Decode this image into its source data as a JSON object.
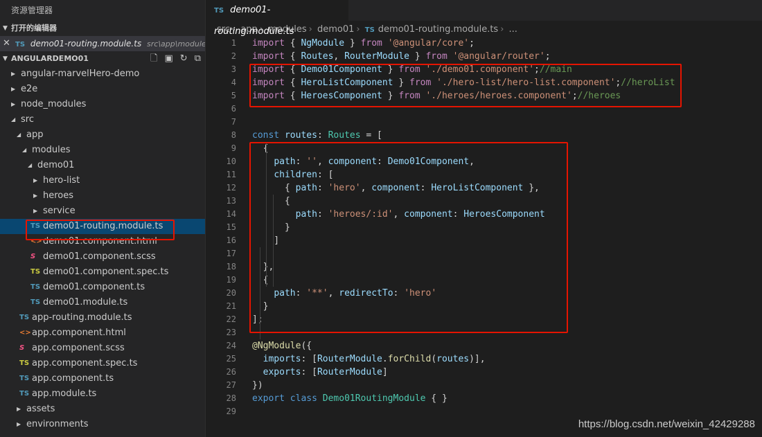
{
  "sidebar": {
    "title": "资源管理器",
    "open_editors": {
      "header": "打开的编辑器",
      "items": [
        {
          "icon": "TS",
          "name": "demo01-routing.module.ts",
          "path": "src\\app\\module..."
        }
      ]
    },
    "project": {
      "header": "ANGULARDEMO01",
      "actions": [
        "new-file-icon",
        "new-folder-icon",
        "refresh-icon",
        "collapse-all-icon"
      ]
    },
    "tree": [
      {
        "label": "angular-marvelHero-demo",
        "type": "folder",
        "depth": 0,
        "expanded": false
      },
      {
        "label": "e2e",
        "type": "folder",
        "depth": 0,
        "expanded": false
      },
      {
        "label": "node_modules",
        "type": "folder",
        "depth": 0,
        "expanded": false
      },
      {
        "label": "src",
        "type": "folder",
        "depth": 0,
        "expanded": true
      },
      {
        "label": "app",
        "type": "folder",
        "depth": 1,
        "expanded": true
      },
      {
        "label": "modules",
        "type": "folder",
        "depth": 2,
        "expanded": true
      },
      {
        "label": "demo01",
        "type": "folder",
        "depth": 3,
        "expanded": true
      },
      {
        "label": "hero-list",
        "type": "folder",
        "depth": 4,
        "expanded": false
      },
      {
        "label": "heroes",
        "type": "folder",
        "depth": 4,
        "expanded": false
      },
      {
        "label": "service",
        "type": "folder",
        "depth": 4,
        "expanded": false
      },
      {
        "label": "demo01-routing.module.ts",
        "type": "ts",
        "icon": "TS",
        "depth": 4,
        "selected": true
      },
      {
        "label": "demo01.component.html",
        "type": "html",
        "icon": "<>",
        "depth": 4
      },
      {
        "label": "demo01.component.scss",
        "type": "scss",
        "icon": "S",
        "depth": 4
      },
      {
        "label": "demo01.component.spec.ts",
        "type": "spec",
        "icon": "TS",
        "depth": 4
      },
      {
        "label": "demo01.component.ts",
        "type": "ts",
        "icon": "TS",
        "depth": 4
      },
      {
        "label": "demo01.module.ts",
        "type": "ts",
        "icon": "TS",
        "depth": 4
      },
      {
        "label": "app-routing.module.ts",
        "type": "ts",
        "icon": "TS",
        "depth": 2
      },
      {
        "label": "app.component.html",
        "type": "html",
        "icon": "<>",
        "depth": 2
      },
      {
        "label": "app.component.scss",
        "type": "scss",
        "icon": "S",
        "depth": 2
      },
      {
        "label": "app.component.spec.ts",
        "type": "spec",
        "icon": "TS",
        "depth": 2
      },
      {
        "label": "app.component.ts",
        "type": "ts",
        "icon": "TS",
        "depth": 2
      },
      {
        "label": "app.module.ts",
        "type": "ts",
        "icon": "TS",
        "depth": 2
      },
      {
        "label": "assets",
        "type": "folder",
        "depth": 1,
        "expanded": false
      },
      {
        "label": "environments",
        "type": "folder",
        "depth": 1,
        "expanded": false
      }
    ]
  },
  "editor": {
    "tab": {
      "icon": "TS",
      "label": "demo01-routing.module.ts"
    },
    "breadcrumb": [
      "src",
      "app",
      "modules",
      "demo01"
    ],
    "breadcrumb_file": {
      "icon": "TS",
      "label": "demo01-routing.module.ts"
    },
    "breadcrumb_more": "...",
    "lines": [
      {
        "n": "1",
        "tokens": [
          [
            "kw2",
            "import"
          ],
          [
            "p",
            " { "
          ],
          [
            "var",
            "NgModule"
          ],
          [
            "p",
            " } "
          ],
          [
            "kw2",
            "from"
          ],
          [
            "p",
            " "
          ],
          [
            "str",
            "'@angular/core'"
          ],
          [
            "p",
            ";"
          ]
        ]
      },
      {
        "n": "2",
        "tokens": [
          [
            "kw2",
            "import"
          ],
          [
            "p",
            " { "
          ],
          [
            "var",
            "Routes"
          ],
          [
            "p",
            ", "
          ],
          [
            "var",
            "RouterModule"
          ],
          [
            "p",
            " } "
          ],
          [
            "kw2",
            "from"
          ],
          [
            "p",
            " "
          ],
          [
            "str",
            "'@angular/router'"
          ],
          [
            "p",
            ";"
          ]
        ]
      },
      {
        "n": "3",
        "tokens": [
          [
            "kw2",
            "import"
          ],
          [
            "p",
            " { "
          ],
          [
            "var",
            "Demo01Component"
          ],
          [
            "p",
            " } "
          ],
          [
            "kw2",
            "from"
          ],
          [
            "p",
            " "
          ],
          [
            "str",
            "'./demo01.component'"
          ],
          [
            "p",
            ";"
          ],
          [
            "cmt",
            "//main"
          ]
        ]
      },
      {
        "n": "4",
        "tokens": [
          [
            "kw2",
            "import"
          ],
          [
            "p",
            " { "
          ],
          [
            "var",
            "HeroListComponent"
          ],
          [
            "p",
            " } "
          ],
          [
            "kw2",
            "from"
          ],
          [
            "p",
            " "
          ],
          [
            "str",
            "'./hero-list/hero-list.component'"
          ],
          [
            "p",
            ";"
          ],
          [
            "cmt",
            "//heroList"
          ]
        ]
      },
      {
        "n": "5",
        "tokens": [
          [
            "kw2",
            "import"
          ],
          [
            "p",
            " { "
          ],
          [
            "var",
            "HeroesComponent"
          ],
          [
            "p",
            " } "
          ],
          [
            "kw2",
            "from"
          ],
          [
            "p",
            " "
          ],
          [
            "str",
            "'./heroes/heroes.component'"
          ],
          [
            "p",
            ";"
          ],
          [
            "cmt",
            "//heroes"
          ]
        ]
      },
      {
        "n": "6",
        "tokens": []
      },
      {
        "n": "7",
        "tokens": []
      },
      {
        "n": "8",
        "tokens": [
          [
            "kw",
            "const"
          ],
          [
            "p",
            " "
          ],
          [
            "var",
            "routes"
          ],
          [
            "p",
            ": "
          ],
          [
            "typ",
            "Routes"
          ],
          [
            "p",
            " = ["
          ]
        ]
      },
      {
        "n": "9",
        "tokens": [
          [
            "p",
            "  {"
          ]
        ]
      },
      {
        "n": "10",
        "tokens": [
          [
            "p",
            "    "
          ],
          [
            "var",
            "path"
          ],
          [
            "p",
            ": "
          ],
          [
            "str",
            "''"
          ],
          [
            "p",
            ", "
          ],
          [
            "var",
            "component"
          ],
          [
            "p",
            ": "
          ],
          [
            "var",
            "Demo01Component"
          ],
          [
            "p",
            ","
          ]
        ]
      },
      {
        "n": "11",
        "tokens": [
          [
            "p",
            "    "
          ],
          [
            "var",
            "children"
          ],
          [
            "p",
            ": ["
          ]
        ]
      },
      {
        "n": "12",
        "tokens": [
          [
            "p",
            "      { "
          ],
          [
            "var",
            "path"
          ],
          [
            "p",
            ": "
          ],
          [
            "str",
            "'hero'"
          ],
          [
            "p",
            ", "
          ],
          [
            "var",
            "component"
          ],
          [
            "p",
            ": "
          ],
          [
            "var",
            "HeroListComponent"
          ],
          [
            "p",
            " },"
          ]
        ]
      },
      {
        "n": "13",
        "tokens": [
          [
            "p",
            "      {"
          ]
        ]
      },
      {
        "n": "14",
        "tokens": [
          [
            "p",
            "        "
          ],
          [
            "var",
            "path"
          ],
          [
            "p",
            ": "
          ],
          [
            "str",
            "'heroes/:id'"
          ],
          [
            "p",
            ", "
          ],
          [
            "var",
            "component"
          ],
          [
            "p",
            ": "
          ],
          [
            "var",
            "HeroesComponent"
          ]
        ]
      },
      {
        "n": "15",
        "tokens": [
          [
            "p",
            "      }"
          ]
        ]
      },
      {
        "n": "16",
        "tokens": [
          [
            "p",
            "    ]"
          ]
        ]
      },
      {
        "n": "17",
        "tokens": []
      },
      {
        "n": "18",
        "tokens": [
          [
            "p",
            "  },"
          ]
        ]
      },
      {
        "n": "19",
        "tokens": [
          [
            "p",
            "  {"
          ]
        ]
      },
      {
        "n": "20",
        "tokens": [
          [
            "p",
            "    "
          ],
          [
            "var",
            "path"
          ],
          [
            "p",
            ": "
          ],
          [
            "str",
            "'**'"
          ],
          [
            "p",
            ", "
          ],
          [
            "var",
            "redirectTo"
          ],
          [
            "p",
            ": "
          ],
          [
            "str",
            "'hero'"
          ]
        ]
      },
      {
        "n": "21",
        "tokens": [
          [
            "p",
            "  }"
          ]
        ]
      },
      {
        "n": "22",
        "tokens": [
          [
            "p",
            "];"
          ]
        ]
      },
      {
        "n": "23",
        "tokens": []
      },
      {
        "n": "24",
        "tokens": [
          [
            "dec",
            "@NgModule"
          ],
          [
            "p",
            "({"
          ]
        ]
      },
      {
        "n": "25",
        "tokens": [
          [
            "p",
            "  "
          ],
          [
            "var",
            "imports"
          ],
          [
            "p",
            ": ["
          ],
          [
            "var",
            "RouterModule"
          ],
          [
            "p",
            "."
          ],
          [
            "fn",
            "forChild"
          ],
          [
            "p",
            "("
          ],
          [
            "var",
            "routes"
          ],
          [
            "p",
            ")],"
          ]
        ]
      },
      {
        "n": "26",
        "tokens": [
          [
            "p",
            "  "
          ],
          [
            "var",
            "exports"
          ],
          [
            "p",
            ": ["
          ],
          [
            "var",
            "RouterModule"
          ],
          [
            "p",
            "]"
          ]
        ]
      },
      {
        "n": "27",
        "tokens": [
          [
            "p",
            "})"
          ]
        ]
      },
      {
        "n": "28",
        "tokens": [
          [
            "kw",
            "export"
          ],
          [
            "p",
            " "
          ],
          [
            "kw",
            "class"
          ],
          [
            "p",
            " "
          ],
          [
            "typ",
            "Demo01RoutingModule"
          ],
          [
            "p",
            " { }"
          ]
        ]
      },
      {
        "n": "29",
        "tokens": []
      }
    ]
  },
  "watermark": "https://blog.csdn.net/weixin_42429288",
  "colors": {
    "highlight": "#e51400",
    "selection": "#094771"
  }
}
